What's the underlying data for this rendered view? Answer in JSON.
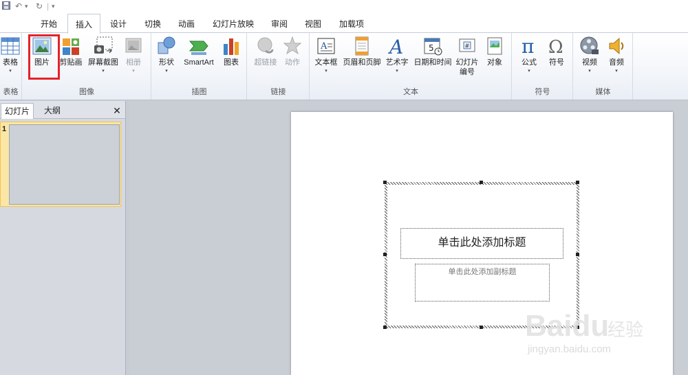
{
  "quick_access": {
    "save": "save-icon",
    "undo": "↶",
    "undo_arrow": "▾",
    "redo": "↻",
    "customize": "▾"
  },
  "tabs": [
    {
      "label": "开始"
    },
    {
      "label": "插入",
      "active": true
    },
    {
      "label": "设计"
    },
    {
      "label": "切换"
    },
    {
      "label": "动画"
    },
    {
      "label": "幻灯片放映"
    },
    {
      "label": "审阅"
    },
    {
      "label": "视图"
    },
    {
      "label": "加载项"
    }
  ],
  "ribbon": {
    "groups": {
      "tables": {
        "label": "表格",
        "table": "表格",
        "table_arrow": "▾"
      },
      "images": {
        "label": "图像",
        "picture": "图片",
        "clipart": "剪贴画",
        "screenshot": "屏幕截图",
        "screenshot_arrow": "▾",
        "album": "相册",
        "album_arrow": "▾"
      },
      "illustrations": {
        "label": "插图",
        "shapes": "形状",
        "shapes_arrow": "▾",
        "smartart": "SmartArt",
        "chart": "图表"
      },
      "links": {
        "label": "链接",
        "hyperlink": "超链接",
        "action": "动作"
      },
      "text": {
        "label": "文本",
        "textbox": "文本框",
        "textbox_arrow": "▾",
        "header_footer": "页眉和页脚",
        "wordart": "艺术字",
        "wordart_arrow": "▾",
        "datetime": "日期和时间",
        "slide_number_1": "幻灯片",
        "slide_number_2": "编号",
        "object": "对象"
      },
      "symbols": {
        "label": "符号",
        "equation": "公式",
        "equation_arrow": "▾",
        "symbol": "符号"
      },
      "media": {
        "label": "媒体",
        "video": "视频",
        "video_arrow": "▾",
        "audio": "音频",
        "audio_arrow": "▾"
      }
    }
  },
  "slide_pane": {
    "tab_slides": "幻灯片",
    "tab_outline": "大纲",
    "close": "✕",
    "slide_number": "1"
  },
  "slide": {
    "title_placeholder": "单击此处添加标题",
    "subtitle_placeholder": "单击此处添加副标题"
  },
  "watermark": {
    "main": "Bai",
    "main2": "du",
    "cn": "经验",
    "url": "jingyan.baidu.com"
  },
  "colors": {
    "highlight": "#e5212a",
    "slide_selected": "#fbe6a6",
    "accent": "#1f5fa8"
  }
}
